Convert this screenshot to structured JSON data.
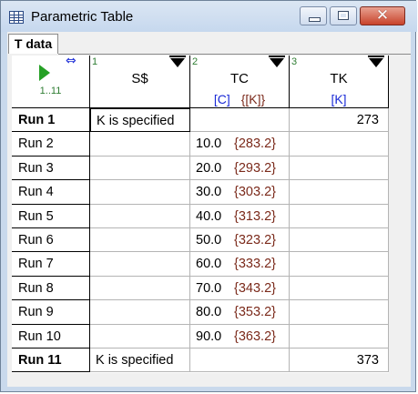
{
  "window": {
    "title": "Parametric Table",
    "close_glyph": "✕"
  },
  "tabs": [
    {
      "label": "T data"
    }
  ],
  "table": {
    "run_header": {
      "range": "1..11",
      "arrows": "⇔"
    },
    "columns": [
      {
        "number": "1",
        "name": "S$",
        "unit": "",
        "unit_alt": ""
      },
      {
        "number": "2",
        "name": "TC",
        "unit": "[C]",
        "unit_alt": "{[K]}"
      },
      {
        "number": "3",
        "name": "TK",
        "unit": "[K]",
        "unit_alt": ""
      }
    ],
    "rows": [
      {
        "run": "Run 1",
        "s": "K is specified",
        "tc": "",
        "tc_k": "",
        "tk": "273"
      },
      {
        "run": "Run 2",
        "s": "",
        "tc": "10.0",
        "tc_k": "{283.2}",
        "tk": ""
      },
      {
        "run": "Run 3",
        "s": "",
        "tc": "20.0",
        "tc_k": "{293.2}",
        "tk": ""
      },
      {
        "run": "Run 4",
        "s": "",
        "tc": "30.0",
        "tc_k": "{303.2}",
        "tk": ""
      },
      {
        "run": "Run 5",
        "s": "",
        "tc": "40.0",
        "tc_k": "{313.2}",
        "tk": ""
      },
      {
        "run": "Run 6",
        "s": "",
        "tc": "50.0",
        "tc_k": "{323.2}",
        "tk": ""
      },
      {
        "run": "Run 7",
        "s": "",
        "tc": "60.0",
        "tc_k": "{333.2}",
        "tk": ""
      },
      {
        "run": "Run 8",
        "s": "",
        "tc": "70.0",
        "tc_k": "{343.2}",
        "tk": ""
      },
      {
        "run": "Run 9",
        "s": "",
        "tc": "80.0",
        "tc_k": "{353.2}",
        "tk": ""
      },
      {
        "run": "Run 10",
        "s": "",
        "tc": "90.0",
        "tc_k": "{363.2}",
        "tk": ""
      },
      {
        "run": "Run 11",
        "s": "K is specified",
        "tc": "",
        "tc_k": "",
        "tk": "373"
      }
    ]
  },
  "colors": {
    "unit": "#1b2bd6",
    "secondary_unit": "#7b2a1b",
    "accent_green": "#25a025",
    "close": "#c8432b"
  }
}
